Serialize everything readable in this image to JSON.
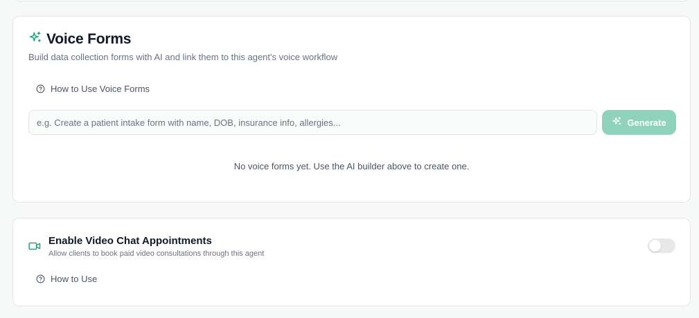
{
  "voice_forms": {
    "title": "Voice Forms",
    "title_icon": "sparkles-icon",
    "subtitle": "Build data collection forms with AI and link them to this agent's voice workflow",
    "how_to_label": "How to Use Voice Forms",
    "input_placeholder": "e.g. Create a patient intake form with name, DOB, insurance info, allergies...",
    "input_value": "",
    "generate_label": "Generate",
    "empty_state": "No voice forms yet. Use the AI builder above to create one."
  },
  "video_chat": {
    "title": "Enable Video Chat Appointments",
    "title_icon": "video-camera-icon",
    "subtitle": "Allow clients to book paid video consultations through this agent",
    "enabled": false,
    "how_to_label": "How to Use"
  },
  "colors": {
    "accent": "#2a9d7c",
    "accent_light": "#8fd3bd",
    "toggle_off": "#e6e8ea"
  }
}
